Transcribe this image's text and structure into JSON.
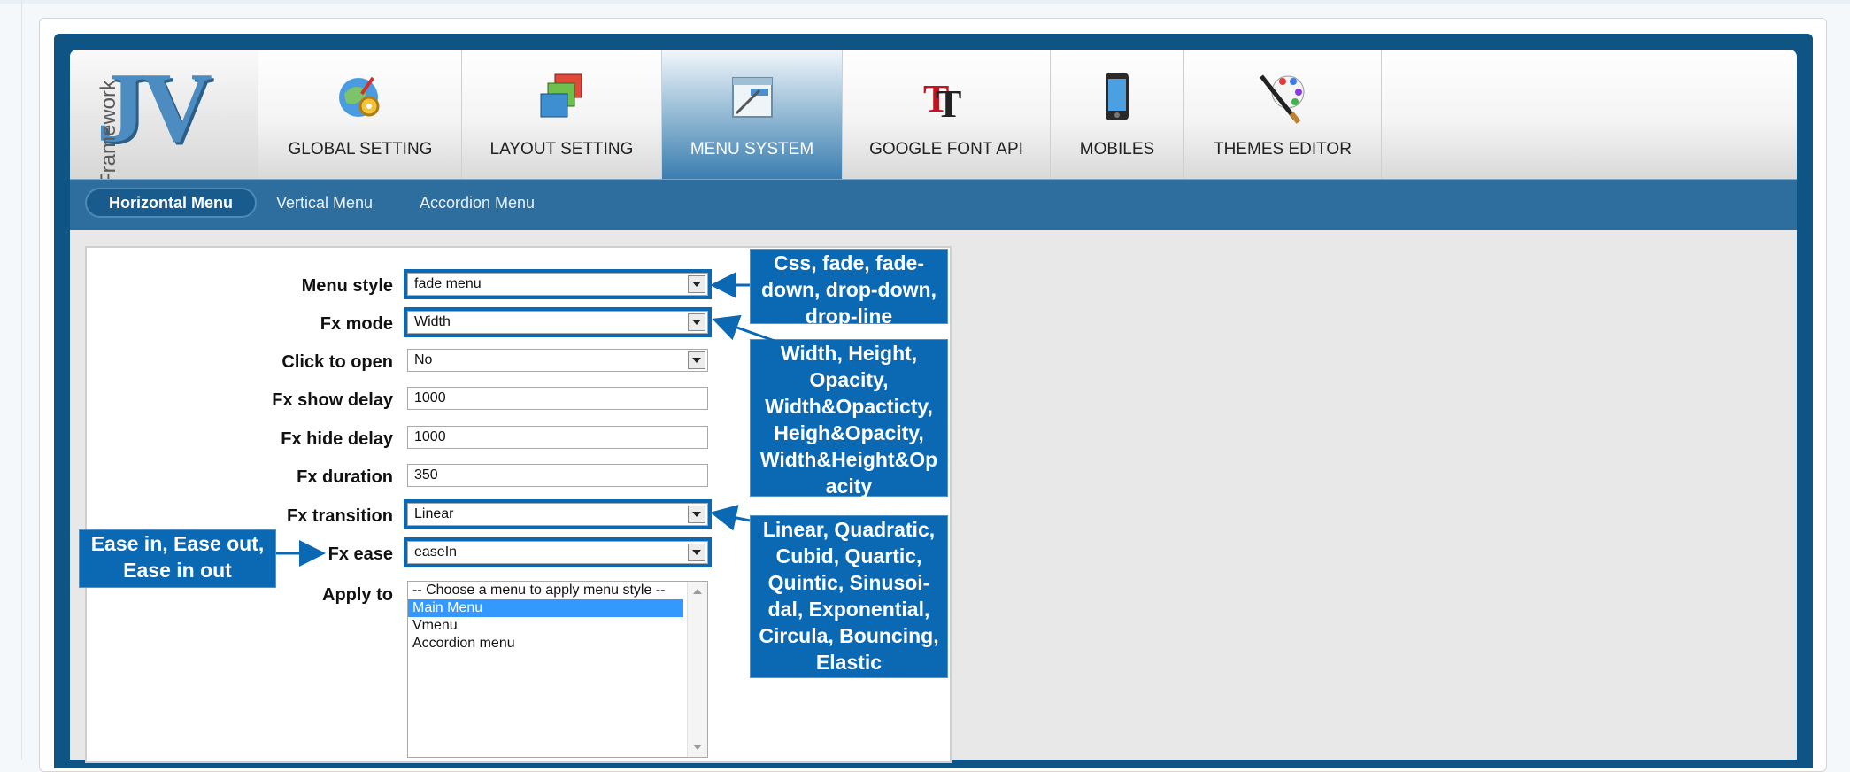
{
  "logo": {
    "main": "JV",
    "sub": "Framework"
  },
  "tabs": [
    {
      "label": "GLOBAL SETTING",
      "icon": "globe-gear-icon"
    },
    {
      "label": "LAYOUT SETTING",
      "icon": "layout-windows-icon"
    },
    {
      "label": "MENU SYSTEM",
      "icon": "menu-window-icon",
      "active": true
    },
    {
      "label": "GOOGLE FONT API",
      "icon": "font-tt-icon"
    },
    {
      "label": "MOBILES",
      "icon": "mobile-phone-icon"
    },
    {
      "label": "THEMES EDITOR",
      "icon": "paint-brush-palette-icon"
    }
  ],
  "subnav": [
    {
      "label": "Horizontal Menu",
      "active": true
    },
    {
      "label": "Vertical Menu"
    },
    {
      "label": "Accordion Menu"
    }
  ],
  "form": {
    "menu_style": {
      "label": "Menu style",
      "value": "fade menu"
    },
    "fx_mode": {
      "label": "Fx mode",
      "value": "Width"
    },
    "click_to_open": {
      "label": "Click to open",
      "value": "No"
    },
    "fx_show_delay": {
      "label": "Fx show delay",
      "value": "1000"
    },
    "fx_hide_delay": {
      "label": "Fx hide delay",
      "value": "1000"
    },
    "fx_duration": {
      "label": "Fx duration",
      "value": "350"
    },
    "fx_transition": {
      "label": "Fx transition",
      "value": "Linear"
    },
    "fx_ease": {
      "label": "Fx ease",
      "value": "easeIn"
    },
    "apply_to": {
      "label": "Apply to",
      "options": [
        "-- Choose a menu to apply menu style --",
        "Main Menu",
        "Vmenu",
        "Accordion menu"
      ],
      "selected": "Main Menu"
    }
  },
  "annotations": {
    "menu_style": [
      "Css, fade, fade-",
      "down, drop-down,",
      "drop-line"
    ],
    "fx_mode": [
      "Width, Height,",
      "Opacity,",
      "Width&Opacticty,",
      "Heigh&Opacity,",
      "Width&Height&Op",
      "acity"
    ],
    "fx_transition": [
      "Linear, Quadratic,",
      "Cubid, Quartic,",
      "Quintic, Sinusoi-",
      "dal, Exponential,",
      "Circula, Bouncing,",
      "Elastic"
    ],
    "fx_ease": [
      "Ease in, Ease out,",
      "Ease in out"
    ]
  },
  "colors": {
    "frame": "#0e5585",
    "subnav": "#2e6e9e",
    "annotation": "#0b69b3",
    "selected_option": "#3399ff"
  }
}
